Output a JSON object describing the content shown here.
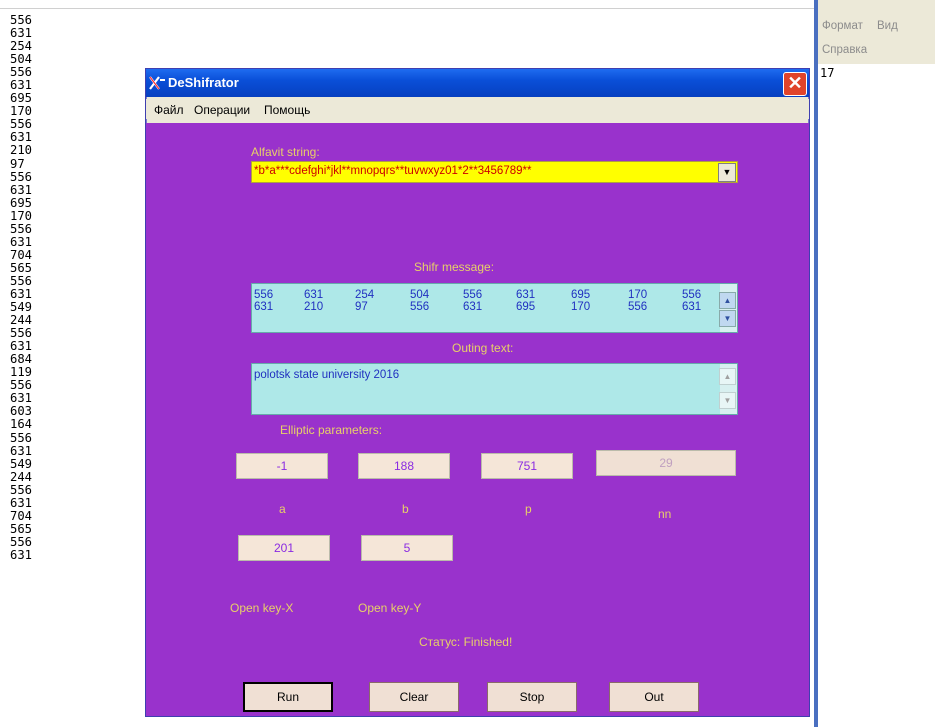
{
  "background_numbers": [
    "556",
    "631",
    "254",
    "504",
    "556",
    "631",
    "695",
    "170",
    "556",
    "631",
    "210",
    "97",
    "556",
    "631",
    "695",
    "170",
    "556",
    "631",
    "704",
    "565",
    "556",
    "631",
    "549",
    "244",
    "556",
    "631",
    "684",
    "119",
    "556",
    "631",
    "603",
    "164",
    "556",
    "631",
    "549",
    "244",
    "556",
    "631",
    "704",
    "565",
    "556",
    "631"
  ],
  "background_right": {
    "menu": [
      "Формат",
      "Вид",
      "Справка"
    ],
    "content": "17"
  },
  "window": {
    "title": "DeShifrator",
    "close_glyph": "✕",
    "menu": [
      "Файл",
      "Операции",
      "Помощь"
    ]
  },
  "alfavit": {
    "label": "Alfavit string:",
    "value": "*b*a***cdefghi*jkl**mnopqrs**tuvwxyz01*2**3456789**"
  },
  "shifr": {
    "label": "Shifr  message:",
    "rows": [
      [
        "556",
        "631",
        "254",
        "504",
        "556",
        "631",
        "695",
        "170",
        "556"
      ],
      [
        "631",
        "210",
        "97",
        "556",
        "631",
        "695",
        "170",
        "556",
        "631"
      ]
    ]
  },
  "outing": {
    "label": "Outing text:",
    "value": "polotsk state university 2016"
  },
  "elliptic": {
    "label": "Elliptic parameters:",
    "fields": [
      {
        "name": "a",
        "value": "-1"
      },
      {
        "name": "b",
        "value": "188"
      },
      {
        "name": "p",
        "value": "751"
      },
      {
        "name": "nn",
        "value": "29"
      }
    ]
  },
  "open_key": {
    "x_value": "201",
    "y_value": "5",
    "x_label": "Open key-X",
    "y_label": "Open key-Y"
  },
  "status": "Статус: Finished!",
  "buttons": {
    "run": "Run",
    "clear": "Clear",
    "stop": "Stop",
    "out": "Out"
  },
  "colors": {
    "client_bg": "#9932cc",
    "label": "#e8d068",
    "combo_bg": "#ffff00",
    "combo_text": "#cc0000",
    "memo_bg": "#aee8e8",
    "memo_text": "#2030c0",
    "field_bg": "#f5e6d8"
  }
}
